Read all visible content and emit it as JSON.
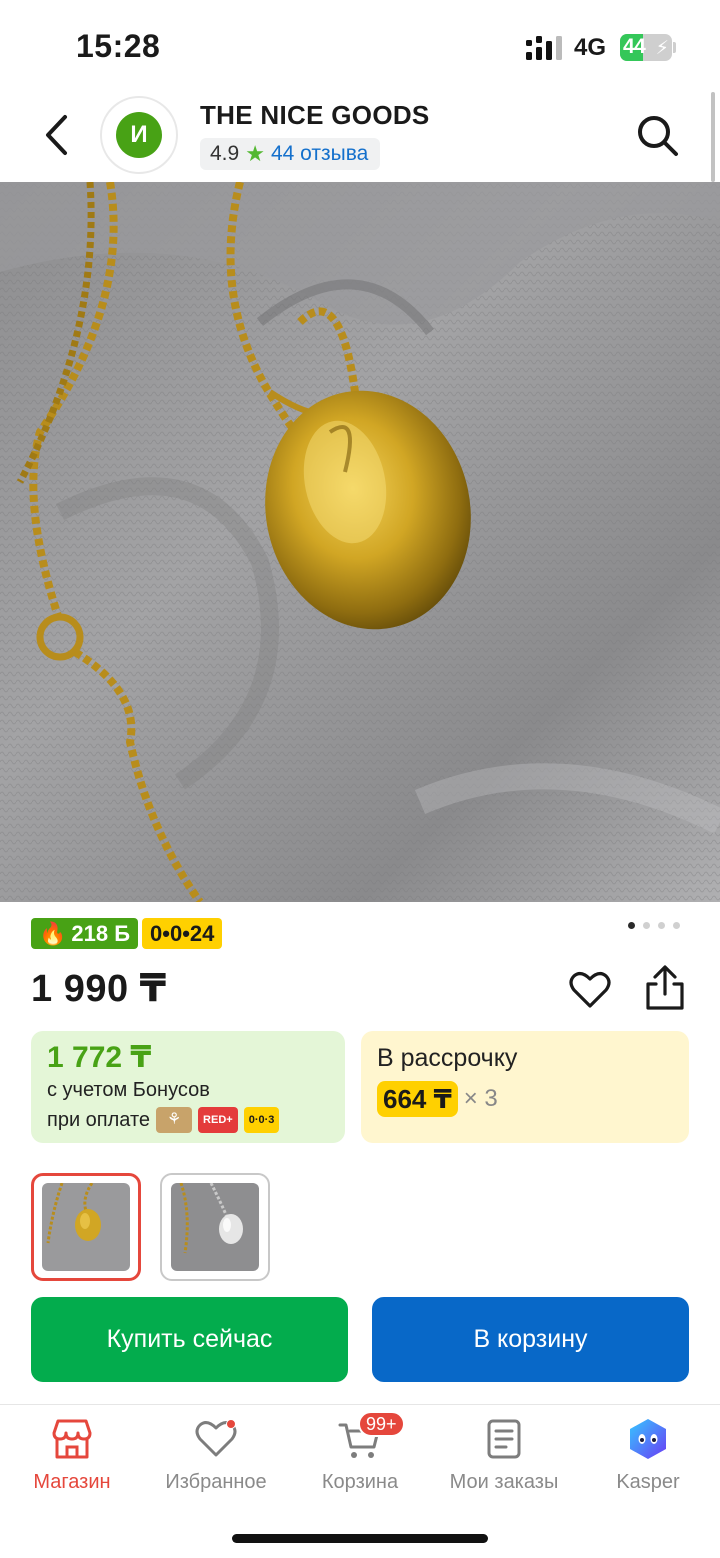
{
  "status_bar": {
    "time": "15:28",
    "network": "4G",
    "battery": "44",
    "battery_level": 0.44
  },
  "header": {
    "store_initial": "И",
    "store_name": "THE NICE GOODS",
    "rating": "4.9",
    "reviews": "44 отзыва"
  },
  "badges": {
    "bonus": "218 Б",
    "installment": "0•0•24"
  },
  "gallery": {
    "image_count": 4,
    "active_index": 0
  },
  "price": "1 990 ₸",
  "bonus_card": {
    "price": "1 772 ₸",
    "note": "с учетом Бонусов",
    "pay_label": "при оплате",
    "chips": [
      "RED+",
      "0·0·3"
    ]
  },
  "installment_card": {
    "title": "В рассрочку",
    "amount": "664 ₸",
    "times": "× 3"
  },
  "actions": {
    "buy_now": "Купить сейчас",
    "add_to_cart": "В корзину"
  },
  "tab_bar": {
    "items": [
      {
        "label": "Магазин",
        "icon": "shop-icon"
      },
      {
        "label": "Избранное",
        "icon": "heart-icon"
      },
      {
        "label": "Корзина",
        "icon": "cart-icon",
        "badge": "99+"
      },
      {
        "label": "Мои заказы",
        "icon": "orders-icon"
      },
      {
        "label": "Kasper",
        "icon": "kasper-icon"
      }
    ]
  },
  "colors": {
    "accent_red": "#e5473c",
    "kaspi_green": "#48a215",
    "buy_green": "#03ac4d",
    "cart_blue": "#0868c8",
    "installment_yellow": "#ffd000"
  }
}
